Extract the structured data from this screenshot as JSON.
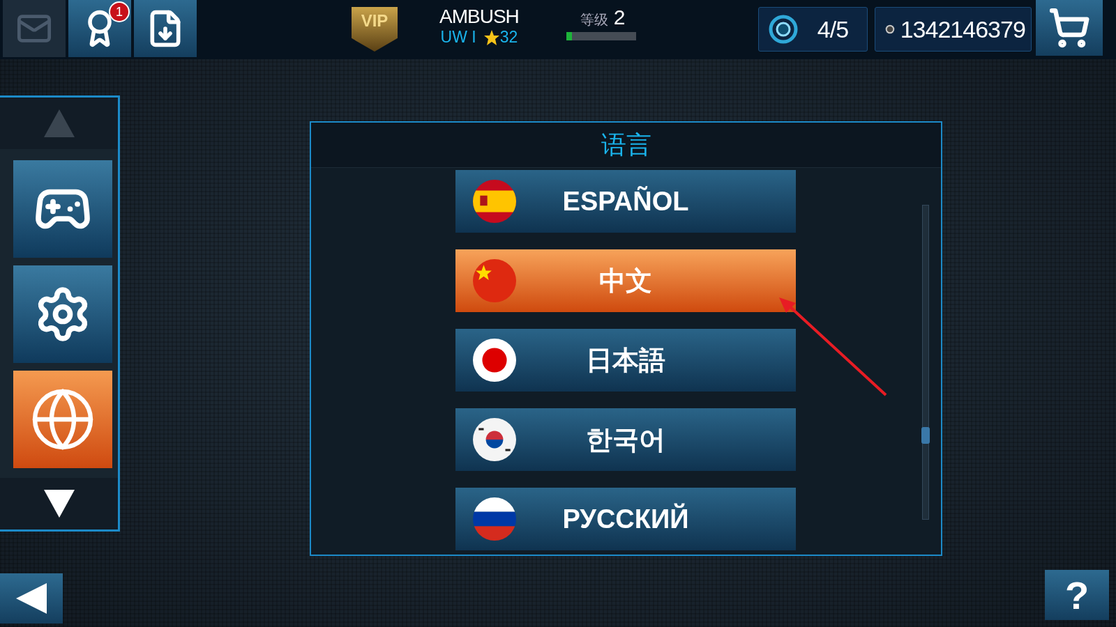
{
  "top_bar": {
    "mail_button": {
      "disabled": true
    },
    "settings_button": {
      "badge": "1"
    },
    "vip_badge": "VIP",
    "player": {
      "name": "AMBUSH",
      "clan": "UW I",
      "stars": "32"
    },
    "level": {
      "label": "等级",
      "value": "2",
      "level": 0.08
    },
    "energy": "4/5",
    "coins": "1342146379"
  },
  "sidebar": {
    "items": [
      {
        "kind": "gamepad",
        "selected": false
      },
      {
        "kind": "gear",
        "selected": false
      },
      {
        "kind": "globe",
        "selected": true
      }
    ]
  },
  "dialog": {
    "title": "语言",
    "languages": [
      {
        "label": "ESPAÑOL",
        "kind": "es",
        "selected": false
      },
      {
        "label": "中文",
        "kind": "cn",
        "selected": true
      },
      {
        "label": "日本語",
        "kind": "jp",
        "selected": false
      },
      {
        "label": "한국어",
        "kind": "kr",
        "selected": false
      },
      {
        "label": "РУССКИЙ",
        "kind": "ru",
        "selected": false
      }
    ]
  },
  "help_button": "?"
}
